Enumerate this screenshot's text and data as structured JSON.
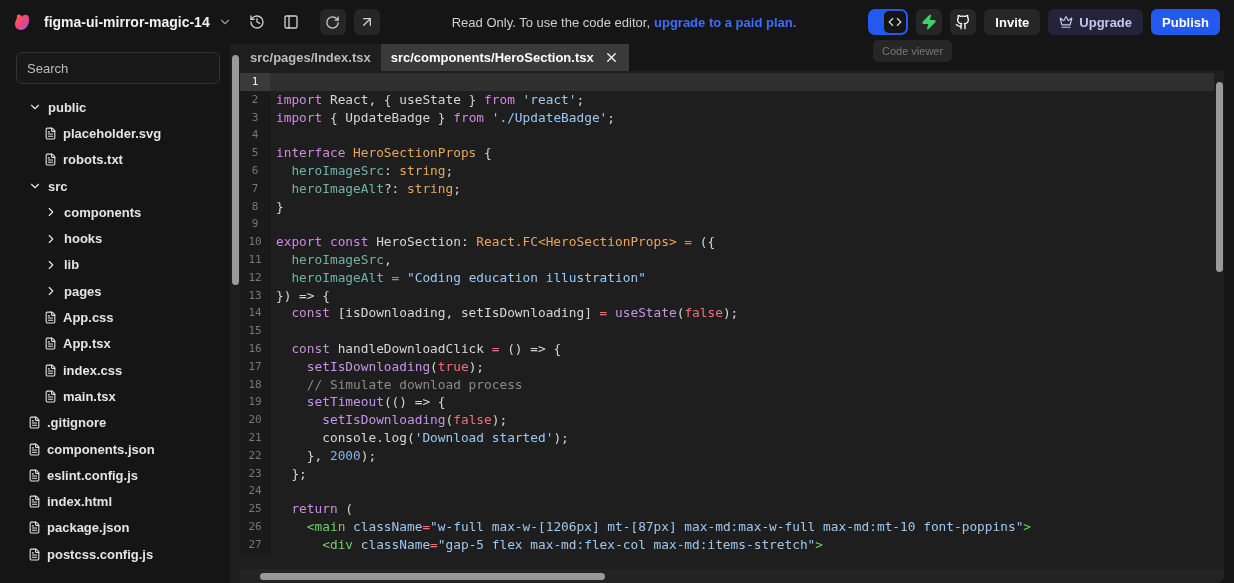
{
  "topbar": {
    "project": "figma-ui-mirror-magic-14",
    "notice": "Read Only. To use the code editor,",
    "notice_link": "upgrade to a paid plan.",
    "code_toggle": {
      "on": true
    },
    "tooltip": "Code viewer",
    "buttons": [
      {
        "label": "Invite",
        "kind": "plain"
      },
      {
        "label": "Upgrade",
        "kind": "upgrade"
      },
      {
        "label": "Publish",
        "kind": "primary"
      }
    ]
  },
  "sidebar": {
    "search": {
      "placeholder": "Search"
    },
    "tree": [
      {
        "name": "public",
        "kind": "folder",
        "expanded": true,
        "children": [
          {
            "name": "placeholder.svg",
            "kind": "file"
          },
          {
            "name": "robots.txt",
            "kind": "file"
          }
        ]
      },
      {
        "name": "src",
        "kind": "folder",
        "expanded": true,
        "children": [
          {
            "name": "components",
            "kind": "folder",
            "expanded": false
          },
          {
            "name": "hooks",
            "kind": "folder",
            "expanded": false
          },
          {
            "name": "lib",
            "kind": "folder",
            "expanded": false
          },
          {
            "name": "pages",
            "kind": "folder",
            "expanded": false
          },
          {
            "name": "App.css",
            "kind": "file"
          },
          {
            "name": "App.tsx",
            "kind": "file"
          },
          {
            "name": "index.css",
            "kind": "file"
          },
          {
            "name": "main.tsx",
            "kind": "file"
          }
        ]
      },
      {
        "name": ".gitignore",
        "kind": "file"
      },
      {
        "name": "components.json",
        "kind": "file"
      },
      {
        "name": "eslint.config.js",
        "kind": "file"
      },
      {
        "name": "index.html",
        "kind": "file"
      },
      {
        "name": "package.json",
        "kind": "file"
      },
      {
        "name": "postcss.config.js",
        "kind": "file"
      }
    ]
  },
  "editor": {
    "tabs": [
      {
        "label": "src/pages/Index.tsx",
        "selected": false
      },
      {
        "label": "src/components/HeroSection.tsx",
        "selected": true
      }
    ],
    "lines": [
      {
        "n": "1",
        "active": true
      },
      {
        "n": "2",
        "active": false,
        "tokens": [
          {
            "kind": "kw",
            "t": "import"
          },
          {
            "kind": "plain",
            "t": " React, { useState } "
          },
          {
            "kind": "kw",
            "t": "from"
          },
          {
            "kind": "str",
            "t": " 'react'"
          },
          {
            "kind": "plain",
            "t": ";"
          }
        ]
      },
      {
        "n": "3",
        "active": false,
        "tokens": [
          {
            "kind": "kw",
            "t": "import"
          },
          {
            "kind": "plain",
            "t": " { UpdateBadge } "
          },
          {
            "kind": "kw",
            "t": "from"
          },
          {
            "kind": "str",
            "t": " './UpdateBadge'"
          },
          {
            "kind": "plain",
            "t": ";"
          }
        ]
      },
      {
        "n": "4",
        "active": false
      },
      {
        "n": "5",
        "active": false,
        "tokens": [
          {
            "kind": "kw",
            "t": "interface"
          },
          {
            "kind": "type",
            "t": " HeroSectionProps"
          },
          {
            "kind": "plain",
            "t": " {"
          }
        ]
      },
      {
        "n": "6",
        "active": false,
        "tokens": [
          {
            "kind": "prop",
            "t": "  heroImageSrc"
          },
          {
            "kind": "plain",
            "t": ": "
          },
          {
            "kind": "type",
            "t": "string"
          },
          {
            "kind": "plain",
            "t": ";"
          }
        ]
      },
      {
        "n": "7",
        "active": false,
        "tokens": [
          {
            "kind": "prop",
            "t": "  heroImageAlt"
          },
          {
            "kind": "plain",
            "t": "?: "
          },
          {
            "kind": "type",
            "t": "string"
          },
          {
            "kind": "plain",
            "t": ";"
          }
        ]
      },
      {
        "n": "8",
        "active": false,
        "tokens": [
          {
            "kind": "plain",
            "t": "}"
          }
        ]
      },
      {
        "n": "9",
        "active": false
      },
      {
        "n": "10",
        "active": false,
        "tokens": [
          {
            "kind": "kw",
            "t": "export const"
          },
          {
            "kind": "plain",
            "t": " HeroSection: "
          },
          {
            "kind": "type",
            "t": "React.FC<HeroSectionProps>"
          },
          {
            "kind": "op",
            "t": " ="
          },
          {
            "kind": "plain",
            "t": " ({"
          }
        ]
      },
      {
        "n": "11",
        "active": false,
        "tokens": [
          {
            "kind": "prop",
            "t": "  heroImageSrc"
          },
          {
            "kind": "plain",
            "t": ","
          }
        ]
      },
      {
        "n": "12",
        "active": false,
        "tokens": [
          {
            "kind": "prop",
            "t": "  heroImageAlt"
          },
          {
            "kind": "op",
            "t": " ="
          },
          {
            "kind": "str",
            "t": " \"Coding education illustration\""
          }
        ]
      },
      {
        "n": "13",
        "active": false,
        "tokens": [
          {
            "kind": "plain",
            "t": "}) => {"
          }
        ]
      },
      {
        "n": "14",
        "active": false,
        "tokens": [
          {
            "kind": "kw",
            "t": "  const"
          },
          {
            "kind": "plain",
            "t": " [isDownloading, setIsDownloading] "
          },
          {
            "kind": "op",
            "t": "="
          },
          {
            "kind": "fn",
            "t": " useState"
          },
          {
            "kind": "plain",
            "t": "("
          },
          {
            "kind": "bool",
            "t": "false"
          },
          {
            "kind": "plain",
            "t": ");"
          }
        ]
      },
      {
        "n": "15",
        "active": false
      },
      {
        "n": "16",
        "active": false,
        "tokens": [
          {
            "kind": "kw",
            "t": "  const"
          },
          {
            "kind": "plain",
            "t": " handleDownloadClick "
          },
          {
            "kind": "op",
            "t": "="
          },
          {
            "kind": "plain",
            "t": " () => {"
          }
        ]
      },
      {
        "n": "17",
        "active": false,
        "tokens": [
          {
            "kind": "fn",
            "t": "    setIsDownloading"
          },
          {
            "kind": "plain",
            "t": "("
          },
          {
            "kind": "bool",
            "t": "true"
          },
          {
            "kind": "plain",
            "t": ");"
          }
        ]
      },
      {
        "n": "18",
        "active": false,
        "tokens": [
          {
            "kind": "comment",
            "t": "    // Simulate download process"
          }
        ]
      },
      {
        "n": "19",
        "active": false,
        "tokens": [
          {
            "kind": "fn",
            "t": "    setTimeout"
          },
          {
            "kind": "plain",
            "t": "(() => {"
          }
        ]
      },
      {
        "n": "20",
        "active": false,
        "tokens": [
          {
            "kind": "fn",
            "t": "      setIsDownloading"
          },
          {
            "kind": "plain",
            "t": "("
          },
          {
            "kind": "bool",
            "t": "false"
          },
          {
            "kind": "plain",
            "t": ");"
          }
        ]
      },
      {
        "n": "21",
        "active": false,
        "tokens": [
          {
            "kind": "plain",
            "t": "      console.log("
          },
          {
            "kind": "str",
            "t": "'Download started'"
          },
          {
            "kind": "plain",
            "t": ");"
          }
        ]
      },
      {
        "n": "22",
        "active": false,
        "tokens": [
          {
            "kind": "plain",
            "t": "    }, "
          },
          {
            "kind": "num",
            "t": "2000"
          },
          {
            "kind": "plain",
            "t": ");"
          }
        ]
      },
      {
        "n": "23",
        "active": false,
        "tokens": [
          {
            "kind": "plain",
            "t": "  };"
          }
        ]
      },
      {
        "n": "24",
        "active": false
      },
      {
        "n": "25",
        "active": false,
        "tokens": [
          {
            "kind": "kw",
            "t": "  return"
          },
          {
            "kind": "plain",
            "t": " ("
          }
        ]
      },
      {
        "n": "26",
        "active": false,
        "tokens": [
          {
            "kind": "tag",
            "t": "    <main"
          },
          {
            "kind": "attr",
            "t": " className"
          },
          {
            "kind": "op",
            "t": "="
          },
          {
            "kind": "str",
            "t": "\"w-full max-w-[1206px] mt-[87px] max-md:max-w-full max-md:mt-10 font-poppins\""
          },
          {
            "kind": "tag",
            "t": ">"
          }
        ]
      },
      {
        "n": "27",
        "active": false,
        "tokens": [
          {
            "kind": "tag",
            "t": "      <div"
          },
          {
            "kind": "attr",
            "t": " className"
          },
          {
            "kind": "op",
            "t": "="
          },
          {
            "kind": "str",
            "t": "\"gap-5 flex max-md:flex-col max-md:items-stretch\""
          },
          {
            "kind": "tag",
            "t": ">"
          }
        ]
      }
    ]
  }
}
